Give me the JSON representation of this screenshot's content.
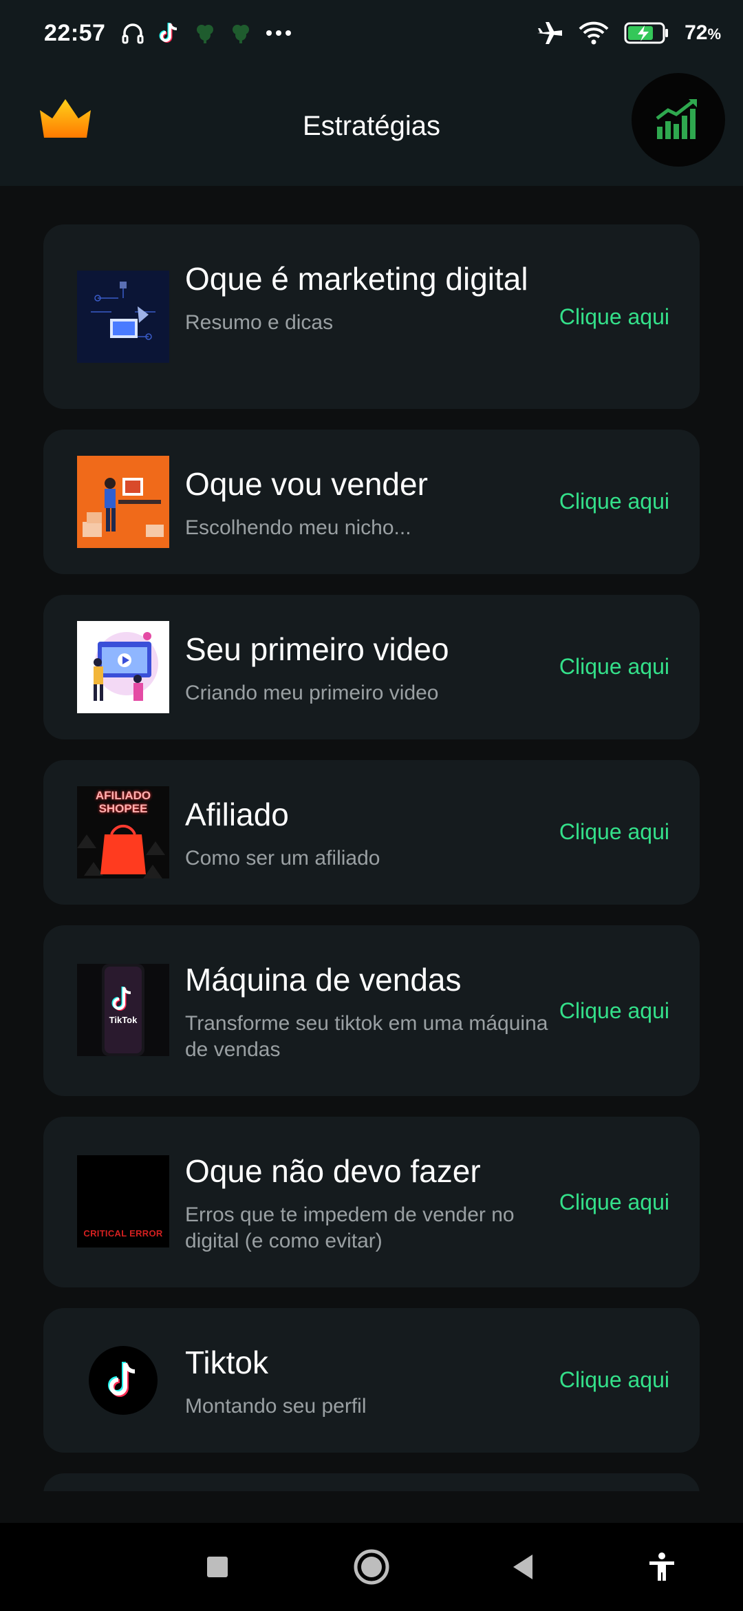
{
  "status_bar": {
    "time": "22:57",
    "battery_percent": "72",
    "battery_unit": "%",
    "icons_left": [
      "headphones-icon",
      "tiktok-icon",
      "notification-icon",
      "notification-icon",
      "more-dots-icon"
    ],
    "icons_right": [
      "airplane-mode-icon",
      "wifi-icon",
      "battery-charging-icon"
    ]
  },
  "header": {
    "title": "Estratégias",
    "left_icon": "crown-icon",
    "right_icon": "growth-chart-icon"
  },
  "colors": {
    "background": "#0d0f10",
    "header": "#121a1d",
    "card": "#151b1e",
    "accent": "#34e08a"
  },
  "cards": [
    {
      "title": "Oque é marketing digital",
      "subtitle": "Resumo e dicas",
      "action": "Clique aqui",
      "thumb": "marketing-illustration"
    },
    {
      "title": "Oque vou vender",
      "subtitle": "Escolhendo meu nicho...",
      "action": "Clique aqui",
      "thumb": "seller-illustration"
    },
    {
      "title": "Seu primeiro video",
      "subtitle": "Criando meu primeiro video",
      "action": "Clique aqui",
      "thumb": "video-illustration"
    },
    {
      "title": "Afiliado",
      "subtitle": "Como ser um afiliado",
      "action": "Clique aqui",
      "thumb": "shopee-bag",
      "thumb_text": "AFILIADO SHOPEE"
    },
    {
      "title": "Máquina de vendas",
      "subtitle": "Transforme seu tiktok em uma máquina de vendas",
      "action": "Clique aqui",
      "thumb": "tiktok-phone",
      "thumb_text": "TikTok"
    },
    {
      "title": "Oque não devo fazer",
      "subtitle": "Erros que te impedem de vender no digital (e como evitar)",
      "action": "Clique aqui",
      "thumb": "critical-error",
      "thumb_text": "CRITICAL ERROR"
    },
    {
      "title": "Tiktok",
      "subtitle": "Montando seu perfil",
      "action": "Clique aqui",
      "thumb": "tiktok-logo"
    }
  ],
  "nav_bar": {
    "buttons": [
      "recents-square-icon",
      "home-circle-icon",
      "back-triangle-icon",
      "accessibility-icon"
    ]
  }
}
